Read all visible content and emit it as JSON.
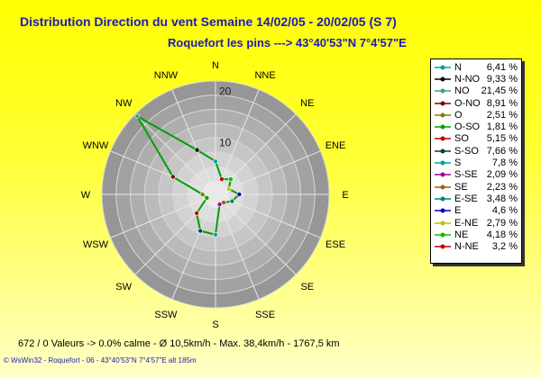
{
  "chart_data": {
    "type": "radar",
    "title": "Distribution Direction du vent   Semaine 14/02/05 - 20/02/05 (S 7)",
    "subtitle": "Roquefort les pins    --->  43°40'53\"N 7°4'57\"E",
    "axis_directions": [
      "N",
      "NNE",
      "NE",
      "ENE",
      "E",
      "ESE",
      "SE",
      "SSE",
      "S",
      "SSW",
      "SW",
      "WSW",
      "W",
      "WNW",
      "NW",
      "NNW"
    ],
    "radial_ticks": [
      10,
      20
    ],
    "rmax": 22,
    "series_color": "#00a000",
    "values": [
      6.41,
      3.2,
      4.18,
      2.79,
      4.6,
      3.48,
      2.23,
      2.09,
      7.8,
      7.66,
      5.15,
      1.81,
      2.51,
      8.91,
      21.45,
      9.33
    ],
    "legend": [
      {
        "label": "N",
        "value": "6,41 %",
        "color": "#00a0a0"
      },
      {
        "label": "N-NO",
        "value": "9,33 %",
        "color": "#000000"
      },
      {
        "label": "NO",
        "value": "21,45 %",
        "color": "#40a080"
      },
      {
        "label": "O-NO",
        "value": "8,91 %",
        "color": "#800000"
      },
      {
        "label": "O",
        "value": "2,51 %",
        "color": "#808000"
      },
      {
        "label": "O-SO",
        "value": "1,81 %",
        "color": "#00a000"
      },
      {
        "label": "SO",
        "value": "5,15 %",
        "color": "#c00000"
      },
      {
        "label": "S-SO",
        "value": "7,66 %",
        "color": "#004040"
      },
      {
        "label": "S",
        "value": "7,8 %",
        "color": "#00a0a0"
      },
      {
        "label": "S-SE",
        "value": "2,09 %",
        "color": "#a000a0"
      },
      {
        "label": "SE",
        "value": "2,23 %",
        "color": "#a06000"
      },
      {
        "label": "E-SE",
        "value": "3,48 %",
        "color": "#008080"
      },
      {
        "label": "E",
        "value": "4,6 %",
        "color": "#0000c0"
      },
      {
        "label": "E-NE",
        "value": "2,79 %",
        "color": "#c0c000"
      },
      {
        "label": "NE",
        "value": "4,18 %",
        "color": "#00c000"
      },
      {
        "label": "N-NE",
        "value": "3,2 %",
        "color": "#c00000"
      }
    ]
  },
  "footer": "672 / 0 Valeurs  -> 0.0% calme   -   Ø 10,5km/h   -  Max. 38,4km/h   -   1767,5 km",
  "credit": "© WsWin32  -  Roquefort - 06  -  43°40'53\"N 7°4'57\"E alt 185m"
}
